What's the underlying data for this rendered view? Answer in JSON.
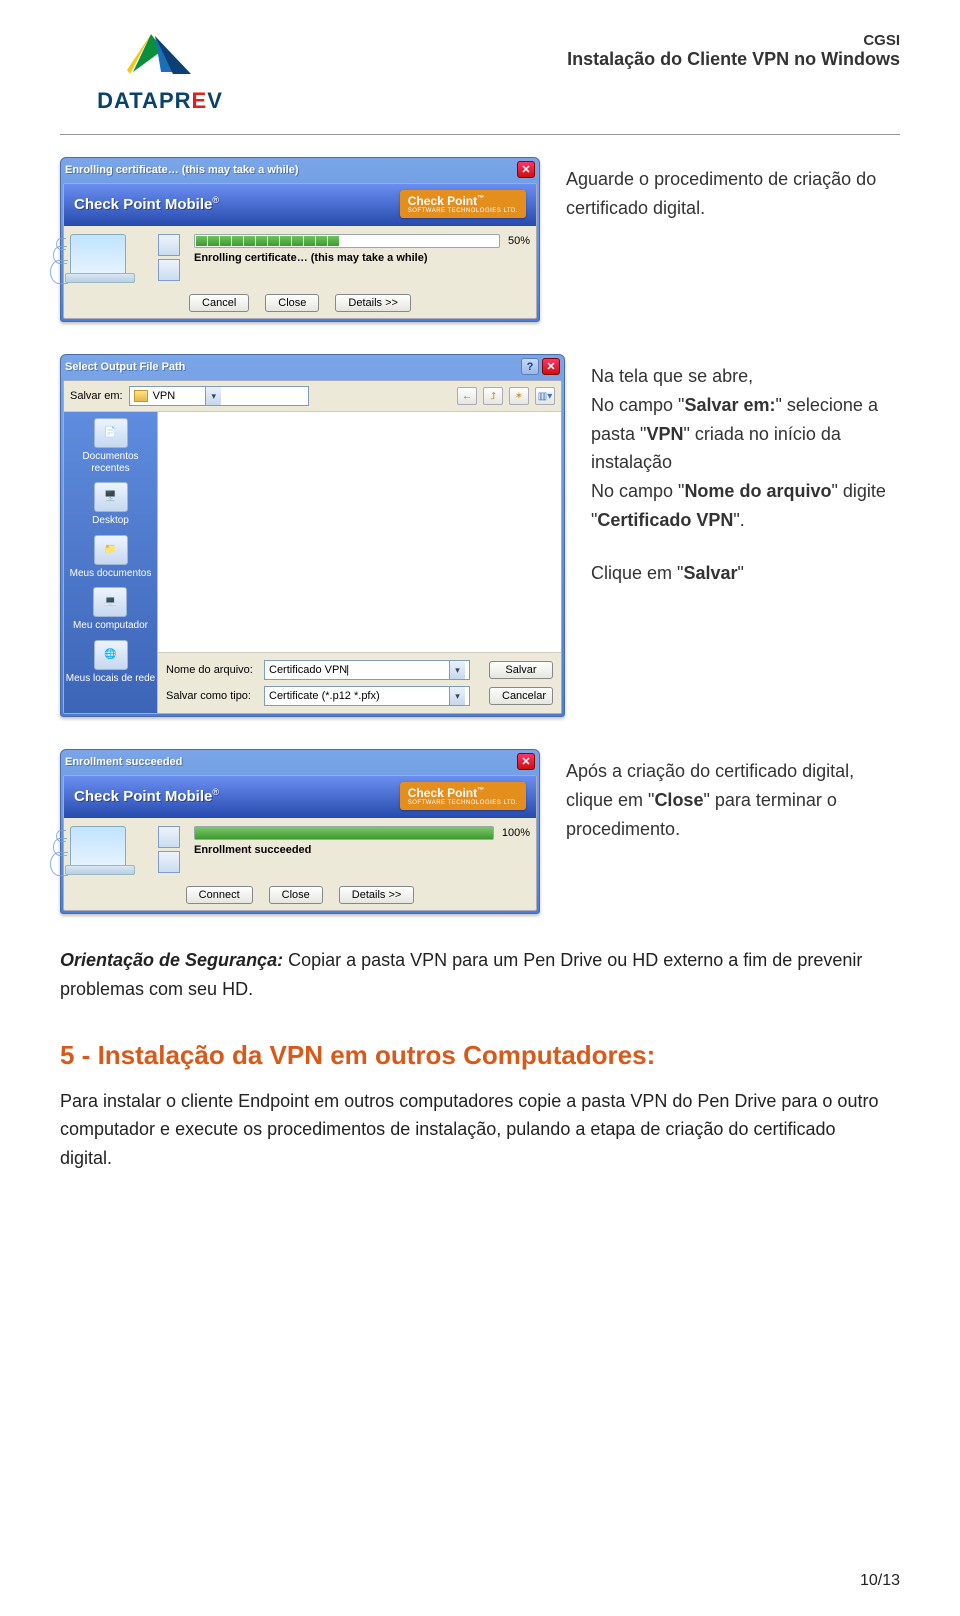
{
  "header": {
    "org": "CGSI",
    "title": "Instalação do Cliente  VPN no Windows",
    "brand_plain": "DATAPR",
    "brand_accent": "E",
    "brand_tail": "V"
  },
  "dialog1": {
    "title": "Enrolling certificate… (this may take a while)",
    "brand": "Check Point Mobile",
    "logo": "Check Point",
    "logo_sub": "SOFTWARE TECHNOLOGIES LTD.",
    "progress_text": "Enrolling certificate… (this may take a while)",
    "percent": "50%",
    "btn_cancel": "Cancel",
    "btn_close": "Close",
    "btn_details": "Details >>"
  },
  "caption1": "Aguarde o procedimento de criação do certificado digital.",
  "savewin": {
    "title": "Select Output File Path",
    "salvarem_label": "Salvar em:",
    "salvarem_value": "VPN",
    "places": [
      "Documentos recentes",
      "Desktop",
      "Meus documentos",
      "Meu computador",
      "Meus locais de rede"
    ],
    "nome_label": "Nome do arquivo:",
    "nome_value": "Certificado VPN",
    "tipo_label": "Salvar como tipo:",
    "tipo_value": "Certificate (*.p12 *.pfx)",
    "btn_salvar": "Salvar",
    "btn_cancelar": "Cancelar"
  },
  "caption2a": "Na tela que se abre,",
  "caption2b_pre": "No campo \"",
  "caption2b_field": "Salvar em:",
  "caption2b_mid": "\" selecione a pasta \"",
  "caption2b_vpn": "VPN",
  "caption2b_post": "\" criada no início da instalação",
  "caption2c_pre": "No campo \"",
  "caption2c_field": "Nome do arquivo",
  "caption2c_mid": "\" digite \"",
  "caption2c_val": "Certificado VPN",
  "caption2c_post": "\".",
  "caption2d_pre": "Clique em \"",
  "caption2d_btn": "Salvar",
  "caption2d_post": "\"",
  "dialog3": {
    "title": "Enrollment succeeded",
    "brand": "Check Point Mobile",
    "logo": "Check Point",
    "logo_sub": "SOFTWARE TECHNOLOGIES LTD.",
    "msg": "Enrollment succeeded",
    "percent": "100%",
    "btn_connect": "Connect",
    "btn_close": "Close",
    "btn_details": "Details >>"
  },
  "caption3_pre": "Após a criação do certificado digital, clique em \"",
  "caption3_btn": "Close",
  "caption3_post": "\" para terminar o procedimento.",
  "sec_lead": "Orientação de Segurança:",
  "sec_body": " Copiar a pasta VPN para um Pen Drive ou HD externo a fim de prevenir problemas com seu HD.",
  "h5": "5 - Instalação da VPN em outros Computadores:",
  "p5": "Para instalar o cliente Endpoint em outros computadores copie a pasta VPN do Pen Drive para o outro computador e execute os procedimentos de instalação, pulando a etapa de criação do certificado digital.",
  "pager": "10/13"
}
